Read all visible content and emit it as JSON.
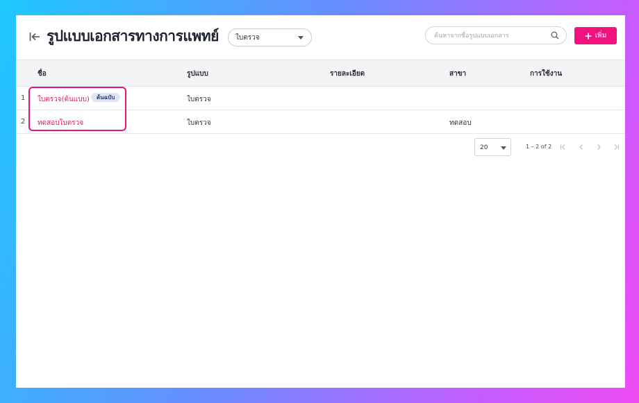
{
  "header": {
    "title": "รูปแบบเอกสารทางการแพทย์",
    "back_icon": "collapse-left-icon",
    "type_filter": {
      "selected": "ใบตรวจ"
    },
    "search": {
      "placeholder": "ค้นหาจากชื่อรูปแบบเอกสาร",
      "value": ""
    },
    "add_label": "เพิ่ม"
  },
  "table": {
    "columns": [
      "ชื่อ",
      "รูปแบบ",
      "รายละเอียด",
      "สาขา",
      "การใช้งาน"
    ],
    "rows": [
      {
        "index": "1",
        "name": "ใบตรวจ(ต้นแบบ)",
        "badge": "ต้นฉบับ",
        "format": "ใบตรวจ",
        "detail": "",
        "branch": "",
        "usage": ""
      },
      {
        "index": "2",
        "name": "ทดสอบใบตรวจ",
        "badge": "",
        "format": "ใบตรวจ",
        "detail": "",
        "branch": "ทดสอบ",
        "usage": ""
      }
    ]
  },
  "pagination": {
    "page_size": "20",
    "range": "1 – 2 of 2"
  },
  "colors": {
    "accent": "#f0137d",
    "link": "#e6176e",
    "highlight": "#e0177c",
    "badge_bg": "#dfe6f5"
  }
}
